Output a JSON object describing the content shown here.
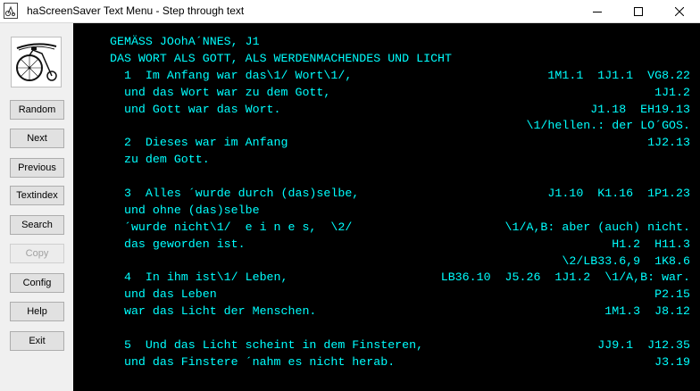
{
  "window": {
    "title": "haScreenSaver Text Menu - Step through text",
    "minimize_icon": "minimize-icon",
    "maximize_icon": "maximize-icon",
    "close_icon": "close-icon"
  },
  "sidebar": {
    "logo_icon": "penny-farthing-bicycle-logo",
    "buttons": {
      "random": "Random",
      "next": "Next",
      "previous": "Previous",
      "textindex": "Textindex",
      "search": "Search",
      "copy": "Copy",
      "config": "Config",
      "help": "Help",
      "exit": "Exit"
    }
  },
  "content": {
    "lines": [
      {
        "left": "GEMÄSS JOohA´NNES, J1",
        "right": ""
      },
      {
        "left": "DAS WORT ALS GOTT, ALS WERDENMACHENDES UND LICHT",
        "right": ""
      },
      {
        "left": "  1  Im Anfang war das\\1/ Wort\\1/,",
        "right": "1M1.1  1J1.1  VG8.22"
      },
      {
        "left": "  und das Wort war zu dem Gott,",
        "right": "1J1.2"
      },
      {
        "left": "  und Gott war das Wort.",
        "right": "J1.18  EH19.13"
      },
      {
        "left": "",
        "right": "\\1/hellen.: der LO´GOS."
      },
      {
        "left": "  2  Dieses war im Anfang",
        "right": "1J2.13"
      },
      {
        "left": "  zu dem Gott.",
        "right": ""
      },
      {
        "left": "",
        "right": ""
      },
      {
        "left": "  3  Alles ´wurde durch (das)selbe,",
        "right": "J1.10  K1.16  1P1.23"
      },
      {
        "left": "  und ohne (das)selbe",
        "right": ""
      },
      {
        "left": "  ´wurde nicht\\1/  e i n e s,  \\2/",
        "right": "\\1/A,B: aber (auch) nicht."
      },
      {
        "left": "  das geworden ist.",
        "right": "H1.2  H11.3"
      },
      {
        "left": "",
        "right": "\\2/LB33.6,9  1K8.6"
      },
      {
        "left": "  4  In ihm ist\\1/ Leben,",
        "right": "LB36.10  J5.26  1J1.2  \\1/A,B: war."
      },
      {
        "left": "  und das Leben",
        "right": "P2.15"
      },
      {
        "left": "  war das Licht der Menschen.",
        "right": "1M1.3  J8.12"
      },
      {
        "left": "",
        "right": ""
      },
      {
        "left": "  5  Und das Licht scheint in dem Finsteren,",
        "right": "JJ9.1  J12.35"
      },
      {
        "left": "  und das Finstere ´nahm es nicht herab.",
        "right": "J3.19"
      }
    ]
  }
}
